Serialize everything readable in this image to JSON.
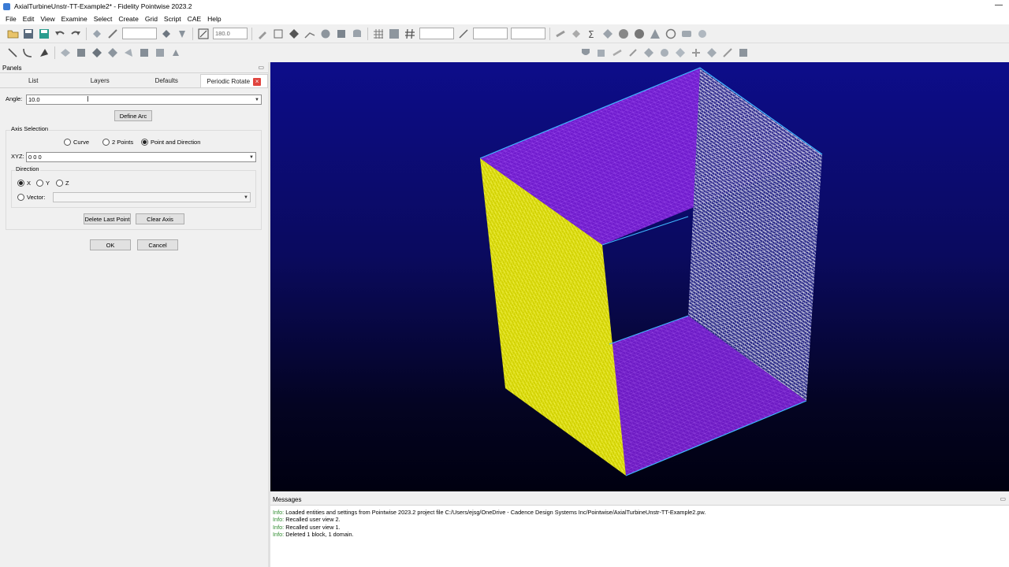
{
  "window": {
    "title": "AxialTurbineUnstr-TT-Example2* - Fidelity Pointwise 2023.2"
  },
  "menu": [
    "File",
    "Edit",
    "View",
    "Examine",
    "Select",
    "Create",
    "Grid",
    "Script",
    "CAE",
    "Help"
  ],
  "toolbar": {
    "angle_value": "180.0"
  },
  "panels": {
    "header": "Panels",
    "tabs": [
      "List",
      "Layers",
      "Defaults",
      "Periodic Rotate"
    ],
    "active_tab": "Periodic Rotate"
  },
  "periodic_rotate": {
    "angle_label": "Angle:",
    "angle_value": "10.0",
    "define_arc_label": "Define Arc",
    "axis_selection_label": "Axis Selection",
    "axis_options": [
      "Curve",
      "2 Points",
      "Point and Direction"
    ],
    "axis_selected": "Point and Direction",
    "xyz_label": "XYZ:",
    "xyz_value": "0 0 0",
    "direction_label": "Direction",
    "direction_options": [
      "X",
      "Y",
      "Z"
    ],
    "direction_selected": "X",
    "vector_label": "Vector:",
    "vector_value": "",
    "delete_last_point_label": "Delete Last Point",
    "clear_axis_label": "Clear Axis",
    "ok_label": "OK",
    "cancel_label": "Cancel"
  },
  "messages": {
    "header": "Messages",
    "lines": [
      {
        "tag": "Info:",
        "text": " Loaded entities and settings from Pointwise 2023.2 project file C:/Users/ejsg/OneDrive - Cadence Design Systems Inc/Pointwise/AxialTurbineUnstr-TT-Example2.pw."
      },
      {
        "tag": "Info:",
        "text": " Recalled user view 2."
      },
      {
        "tag": "Info:",
        "text": " Recalled user view 1."
      },
      {
        "tag": "Info:",
        "text": " Deleted 1 block, 1 domain."
      }
    ]
  },
  "colors": {
    "viewport_top": "#0d0d8a",
    "viewport_bottom": "#000010",
    "mesh_purple": "#8a2be2",
    "mesh_yellow": "#ffff00",
    "mesh_white": "#ffffff",
    "edge_cyan": "#3fb8ff",
    "info_green": "#2c8a2c"
  }
}
